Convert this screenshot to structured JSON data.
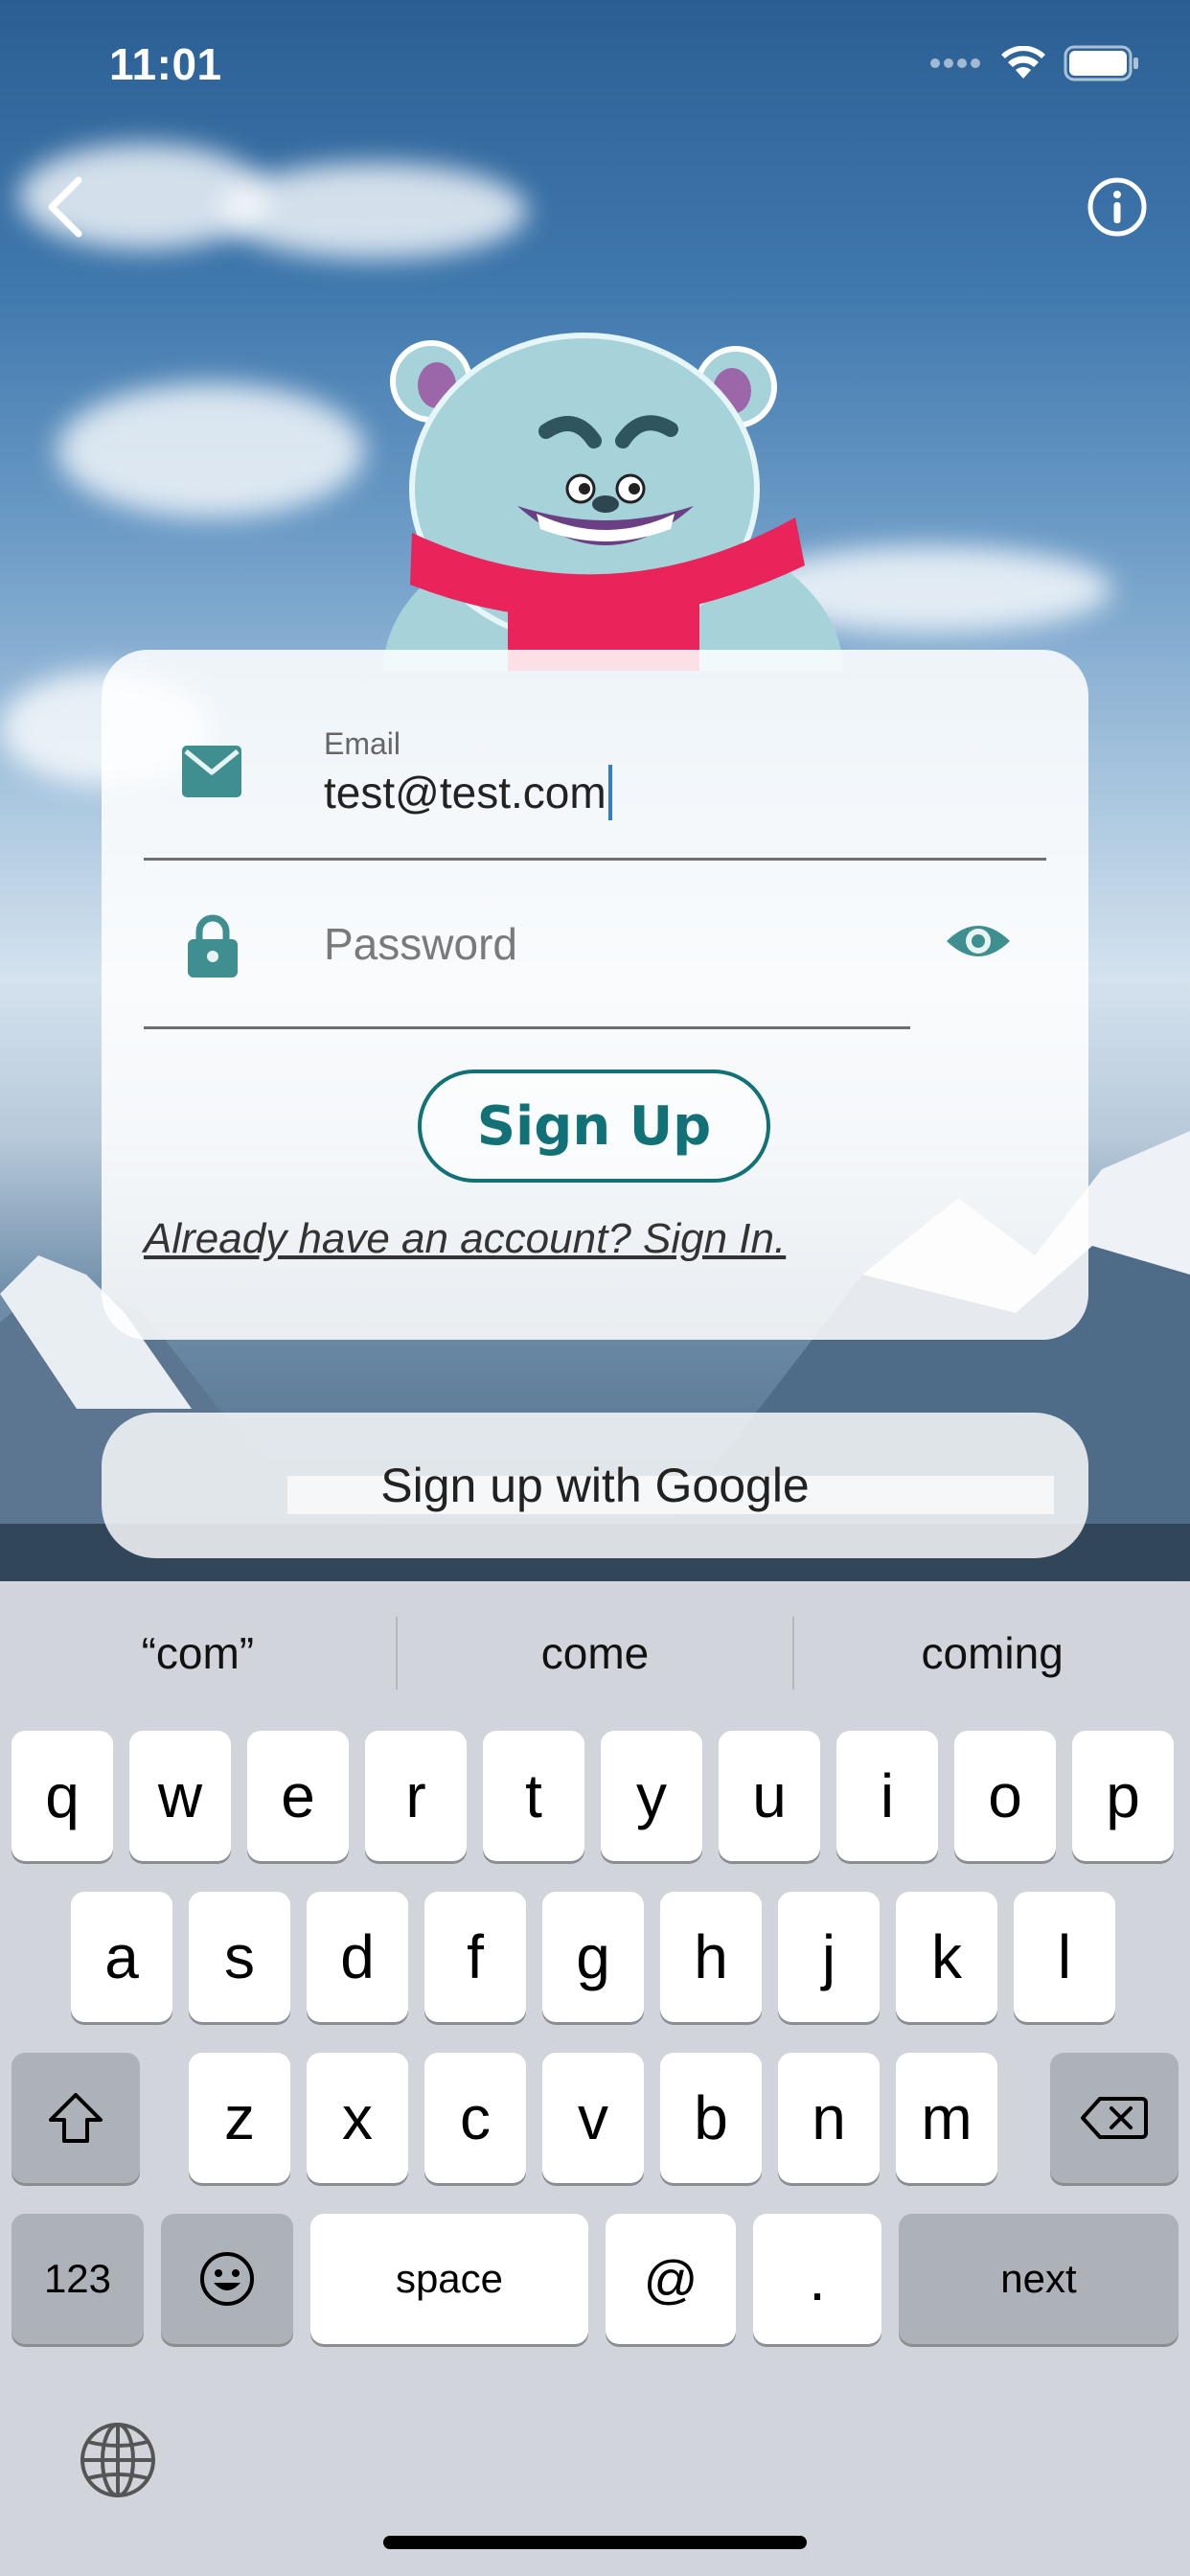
{
  "status_bar": {
    "time": "11:01",
    "wifi_icon": "wifi-icon",
    "battery_icon": "battery-icon"
  },
  "nav": {
    "back_icon": "chevron-left-icon",
    "info_icon": "info-icon"
  },
  "form": {
    "email_label": "Email",
    "email_value": "test@test.com",
    "password_placeholder": "Password",
    "signup_label": "Sign Up",
    "signin_link": "Already have an account? Sign In."
  },
  "google_button": {
    "label": "Sign up with Google"
  },
  "keyboard": {
    "suggestions": [
      "“com”",
      "come",
      "coming"
    ],
    "row1": [
      "q",
      "w",
      "e",
      "r",
      "t",
      "y",
      "u",
      "i",
      "o",
      "p"
    ],
    "row2": [
      "a",
      "s",
      "d",
      "f",
      "g",
      "h",
      "j",
      "k",
      "l"
    ],
    "row3": [
      "z",
      "x",
      "c",
      "v",
      "b",
      "n",
      "m"
    ],
    "numbers_label": "123",
    "space_label": "space",
    "at_label": "@",
    "period_label": ".",
    "next_label": "next"
  },
  "colors": {
    "accent": "#127176",
    "icon_teal": "#3f8e90",
    "scarf": "#e8245a"
  }
}
